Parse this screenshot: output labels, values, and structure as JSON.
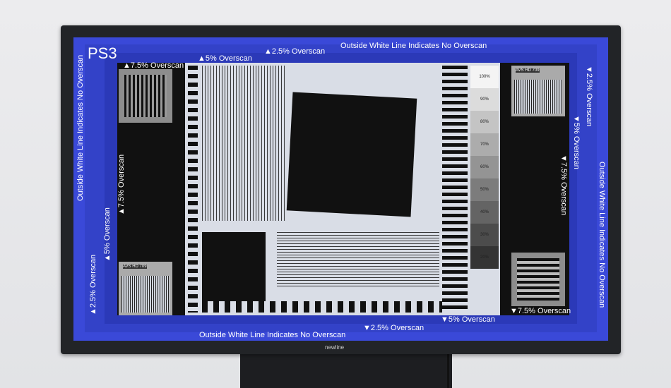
{
  "screen": {
    "corner_label": "PS3",
    "overscan": {
      "top_no": "Outside White Line Indicates No Overscan",
      "bottom_no": "Outside White Line Indicates No Overscan",
      "left_no": "Outside White Line Indicates No Overscan",
      "right_no": "Outside White Line Indicates No Overscan",
      "top_25": "▲2.5% Overscan",
      "top_5": "▲5% Overscan",
      "top_75": "▲7.5% Overscan",
      "bottom_25": "▼2.5% Overscan",
      "bottom_5": "▼5% Overscan",
      "bottom_75": "▼7.5% Overscan",
      "left_25": "▲2.5% Overscan",
      "left_5": "▲5% Overscan",
      "left_75": "▲7.5% Overscan",
      "right_25": "▼2.5% Overscan",
      "right_5": "▼5% Overscan",
      "right_75": "▼7.5% Overscan"
    },
    "avs_label": "AVS HD 709",
    "gray_steps": [
      "100%",
      "90%",
      "80%",
      "70%",
      "60%",
      "50%",
      "40%",
      "30%",
      "20%"
    ]
  },
  "monitor": {
    "brand": "newline"
  }
}
